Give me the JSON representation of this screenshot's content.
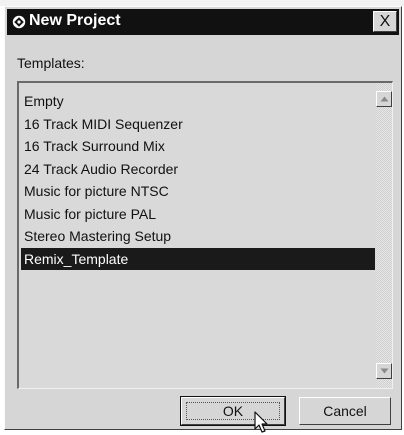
{
  "dialog": {
    "title": "New Project",
    "close_label": "X"
  },
  "templates": {
    "label": "Templates:",
    "items": [
      {
        "label": "Empty",
        "selected": false
      },
      {
        "label": "16 Track MIDI Sequenzer",
        "selected": false
      },
      {
        "label": "16 Track Surround Mix",
        "selected": false
      },
      {
        "label": "24 Track Audio Recorder",
        "selected": false
      },
      {
        "label": "Music for picture NTSC",
        "selected": false
      },
      {
        "label": "Music for picture PAL",
        "selected": false
      },
      {
        "label": "Stereo Mastering Setup",
        "selected": false
      },
      {
        "label": "Remix_Template",
        "selected": true
      }
    ]
  },
  "buttons": {
    "ok_label": "OK",
    "cancel_label": "Cancel"
  },
  "icons": {
    "title_icon": "app-logo-icon",
    "scroll_up": "arrow-up-icon",
    "scroll_down": "arrow-down-icon",
    "cursor": "mouse-pointer-icon"
  },
  "colors": {
    "titlebar": "#111111",
    "selection": "#1a1a1a",
    "dialog_face": "#d6d6d6"
  }
}
